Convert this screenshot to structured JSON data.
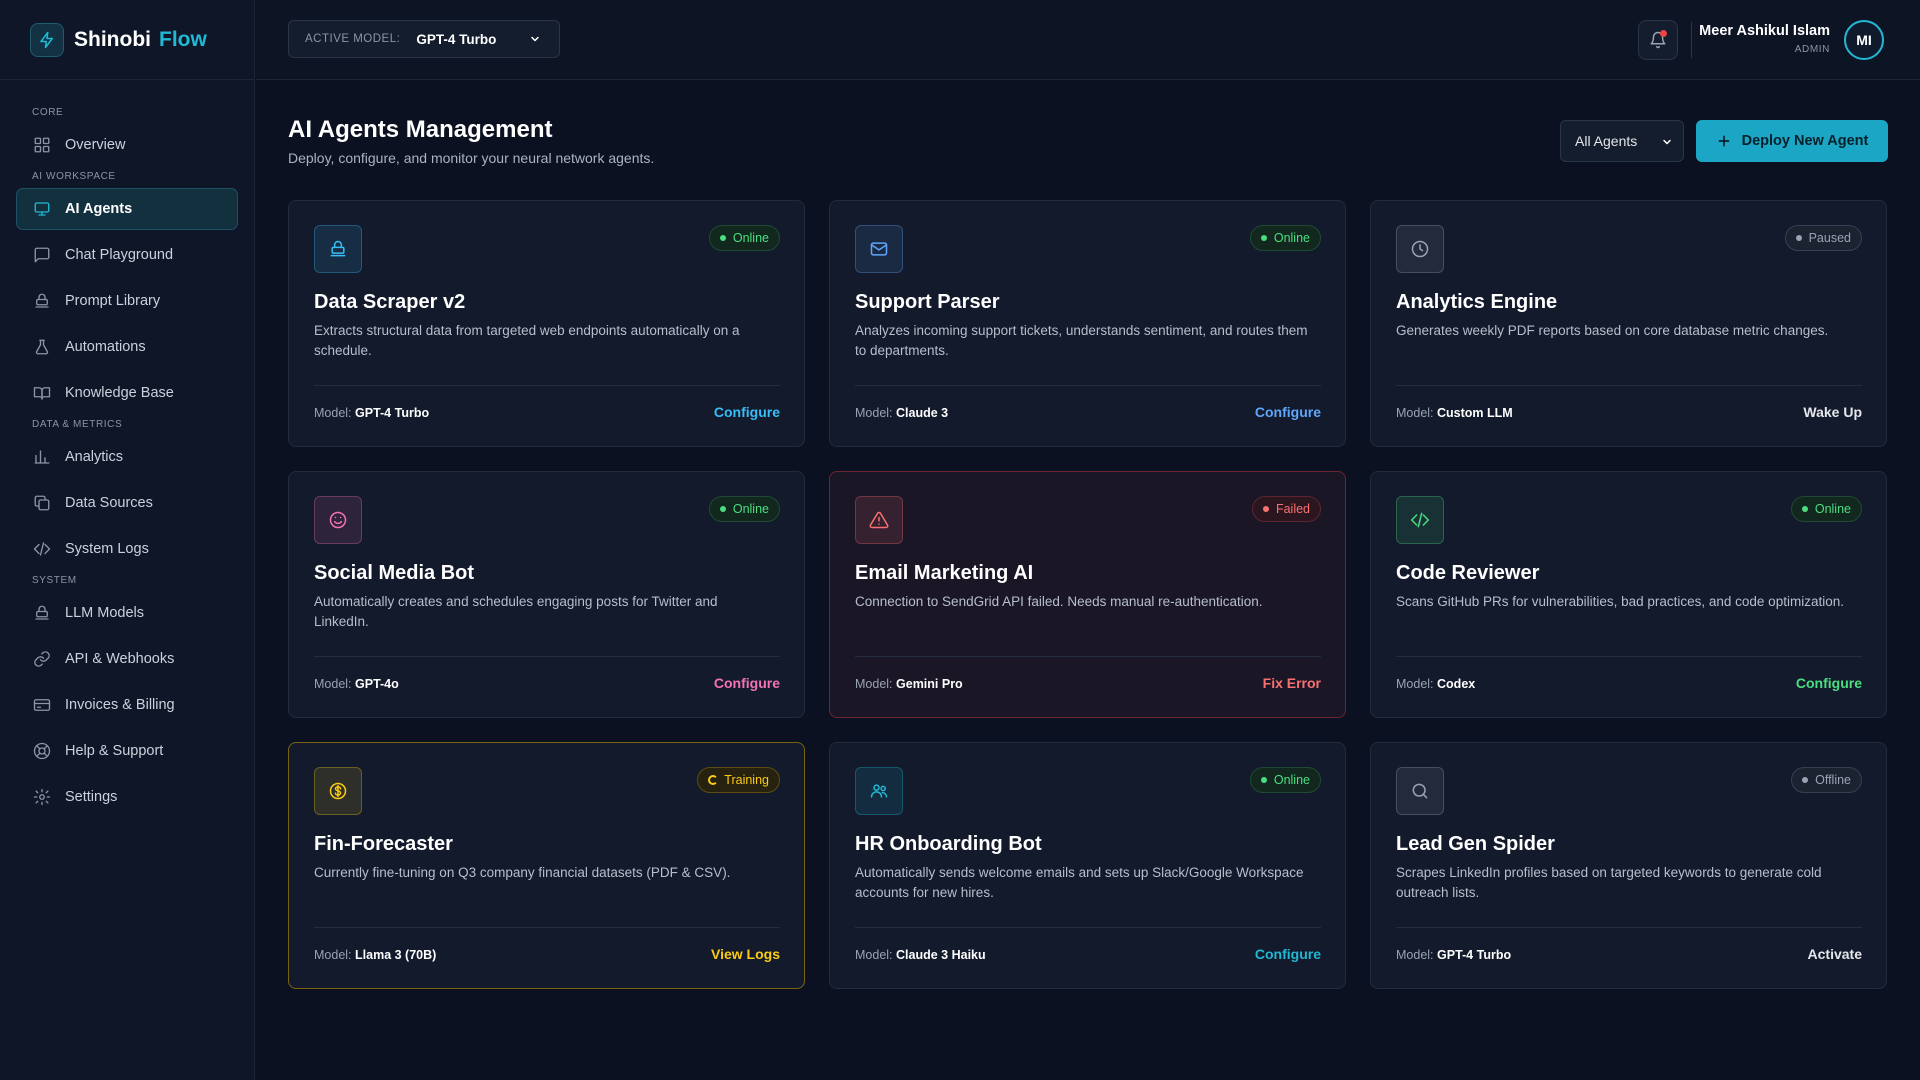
{
  "brand": {
    "name": "Shinobi",
    "accent": "Flow"
  },
  "sidebar": {
    "sections": [
      {
        "title": "CORE",
        "items": [
          {
            "label": "Overview",
            "icon": "grid-icon"
          }
        ]
      },
      {
        "title": "AI WORKSPACE",
        "items": [
          {
            "label": "AI Agents",
            "icon": "monitor-icon",
            "active": true
          },
          {
            "label": "Chat Playground",
            "icon": "chat-icon"
          },
          {
            "label": "Prompt Library",
            "icon": "stack-icon"
          },
          {
            "label": "Automations",
            "icon": "flask-icon"
          },
          {
            "label": "Knowledge Base",
            "icon": "book-icon"
          }
        ]
      },
      {
        "title": "DATA & METRICS",
        "items": [
          {
            "label": "Analytics",
            "icon": "bar-chart-icon"
          },
          {
            "label": "Data Sources",
            "icon": "copy-icon"
          },
          {
            "label": "System Logs",
            "icon": "code-icon"
          }
        ]
      },
      {
        "title": "SYSTEM",
        "items": [
          {
            "label": "LLM Models",
            "icon": "stack-icon"
          },
          {
            "label": "API & Webhooks",
            "icon": "link-icon"
          },
          {
            "label": "Invoices & Billing",
            "icon": "card-icon"
          },
          {
            "label": "Help & Support",
            "icon": "lifebuoy-icon"
          },
          {
            "label": "Settings",
            "icon": "gear-icon"
          }
        ]
      }
    ]
  },
  "header": {
    "model_label": "ACTIVE MODEL:",
    "model_value": "GPT-4 Turbo",
    "user_name": "Meer Ashikul Islam",
    "user_role": "ADMIN",
    "user_initials": "MI"
  },
  "main": {
    "title": "AI Agents Management",
    "subtitle": "Deploy, configure, and monitor your neural network agents.",
    "filter_value": "All Agents",
    "deploy_label": "Deploy New Agent"
  },
  "colors": {
    "accent": "#22b8d4",
    "online": "#4ade80",
    "failed": "#f87171",
    "training": "#facc15",
    "pink": "#f472b6",
    "blue": "#60a5fa"
  },
  "agents": [
    {
      "name": "Data Scraper v2",
      "desc": "Extracts structural data from targeted web endpoints automatically on a schedule.",
      "model_label": "Model:",
      "model": "GPT-4 Turbo",
      "status": "Online",
      "status_type": "online",
      "action": "Configure",
      "action_color": "#38bdf8",
      "icon": "stack-icon",
      "icon_color": "#38bdf8",
      "variant": "normal"
    },
    {
      "name": "Support Parser",
      "desc": "Analyzes incoming support tickets, understands sentiment, and routes them to departments.",
      "model_label": "Model:",
      "model": "Claude 3",
      "status": "Online",
      "status_type": "online",
      "action": "Configure",
      "action_color": "#60a5fa",
      "icon": "mail-icon",
      "icon_color": "#60a5fa",
      "variant": "normal"
    },
    {
      "name": "Analytics Engine",
      "desc": "Generates weekly PDF reports based on core database metric changes.",
      "model_label": "Model:",
      "model": "Custom LLM",
      "status": "Paused",
      "status_type": "paused",
      "action": "Wake Up",
      "action_color": "#e5e7eb",
      "icon": "clock-icon",
      "icon_color": "#9aa3b2",
      "variant": "normal"
    },
    {
      "name": "Social Media Bot",
      "desc": "Automatically creates and schedules engaging posts for Twitter and LinkedIn.",
      "model_label": "Model:",
      "model": "GPT-4o",
      "status": "Online",
      "status_type": "online",
      "action": "Configure",
      "action_color": "#f472b6",
      "icon": "smile-icon",
      "icon_color": "#f472b6",
      "variant": "normal"
    },
    {
      "name": "Email Marketing AI",
      "desc": "Connection to SendGrid API failed. Needs manual re-authentication.",
      "model_label": "Model:",
      "model": "Gemini Pro",
      "status": "Failed",
      "status_type": "failed",
      "action": "Fix Error",
      "action_color": "#f87171",
      "icon": "warning-icon",
      "icon_color": "#f87171",
      "variant": "failed"
    },
    {
      "name": "Code Reviewer",
      "desc": "Scans GitHub PRs for vulnerabilities, bad practices, and code optimization.",
      "model_label": "Model:",
      "model": "Codex",
      "status": "Online",
      "status_type": "online",
      "action": "Configure",
      "action_color": "#4ade80",
      "icon": "code-icon",
      "icon_color": "#4ade80",
      "variant": "normal"
    },
    {
      "name": "Fin-Forecaster",
      "desc": "Currently fine-tuning on Q3 company financial datasets (PDF & CSV).",
      "model_label": "Model:",
      "model": "Llama 3 (70B)",
      "status": "Training",
      "status_type": "training",
      "action": "View Logs",
      "action_color": "#facc15",
      "icon": "dollar-icon",
      "icon_color": "#facc15",
      "variant": "training"
    },
    {
      "name": "HR Onboarding Bot",
      "desc": "Automatically sends welcome emails and sets up Slack/Google Workspace accounts for new hires.",
      "model_label": "Model:",
      "model": "Claude 3 Haiku",
      "status": "Online",
      "status_type": "online",
      "action": "Configure",
      "action_color": "#22b8d4",
      "icon": "users-icon",
      "icon_color": "#22b8d4",
      "variant": "normal"
    },
    {
      "name": "Lead Gen Spider",
      "desc": "Scrapes LinkedIn profiles based on targeted keywords to generate cold outreach lists.",
      "model_label": "Model:",
      "model": "GPT-4 Turbo",
      "status": "Offline",
      "status_type": "offline",
      "action": "Activate",
      "action_color": "#e5e7eb",
      "icon": "search-icon",
      "icon_color": "#9aa3b2",
      "variant": "normal"
    }
  ]
}
